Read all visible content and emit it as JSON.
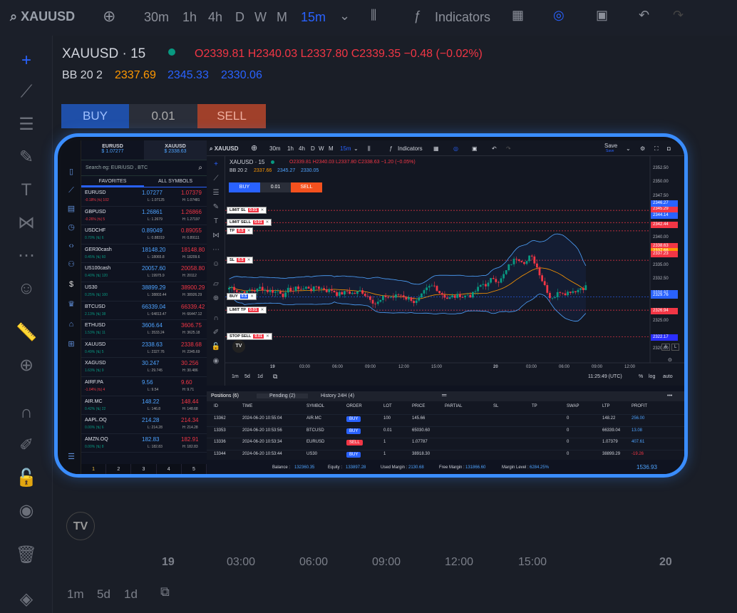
{
  "bg": {
    "symbol": "XAUUSD",
    "intervals": [
      "30m",
      "1h",
      "4h",
      "D",
      "W",
      "M",
      "15m"
    ],
    "indicators_label": "Indicators",
    "legend_title": "XAUUSD · 15",
    "ohlc": "O2339.81 H2340.03 L2337.80 C2339.35 −0.48 (−0.02%)",
    "bb": "BB 20 2",
    "bb_vals": [
      "2337.69",
      "2345.33",
      "2330.06"
    ],
    "buy": "BUY",
    "qty": "0.01",
    "sell": "SELL",
    "time_labels": [
      "19",
      "03:00",
      "06:00",
      "09:00",
      "12:00",
      "15:00",
      "20"
    ],
    "ranges": [
      "1m",
      "5d",
      "1d"
    ]
  },
  "watchlist": {
    "header": [
      {
        "sym": "EURUSD",
        "price": "$ 1.07277"
      },
      {
        "sym": "XAUUSD",
        "price": "$ 2338.63"
      }
    ],
    "search_placeholder": "Search eg: EUR/USD , BTC",
    "tabs": [
      "FAVORITES",
      "ALL SYMBOLS"
    ],
    "rows": [
      {
        "sym": "EURUSD",
        "chg": "-0.18% |⇅| 102",
        "bid": "1.07277",
        "ask": "1.07379",
        "lo": "L: 1.07125",
        "hi": "H: 1.07481",
        "up": false
      },
      {
        "sym": "GBPUSD",
        "chg": "-0.26% |⇅| 5",
        "bid": "1.26861",
        "ask": "1.26866",
        "lo": "L: 1.2679",
        "hi": "H: 1.27197",
        "up": false
      },
      {
        "sym": "USDCHF",
        "chg": "0.70% |⇅| 6",
        "bid": "0.89049",
        "ask": "0.89055",
        "lo": "L: 0.88319",
        "hi": "H: 0.89111",
        "up": true
      },
      {
        "sym": "GER30cash",
        "chg": "0.45% |⇅| 60",
        "bid": "18148.20",
        "ask": "18148.80",
        "lo": "L: 18065.8",
        "hi": "H: 18209.6",
        "up": true
      },
      {
        "sym": "US100cash",
        "chg": "0.40% |⇅| 120",
        "bid": "20057.60",
        "ask": "20058.80",
        "lo": "L: 19975.9",
        "hi": "H: 20112",
        "up": true
      },
      {
        "sym": "US30",
        "chg": "0.25% |⇅| 100",
        "bid": "38899.29",
        "ask": "38900.29",
        "lo": "L: 38803.44",
        "hi": "H: 38926.29",
        "up": true
      },
      {
        "sym": "BTCUSD",
        "chg": "2.13% |⇅| 38",
        "bid": "66339.04",
        "ask": "66339.42",
        "lo": "L: 64813.47",
        "hi": "H: 66447.12",
        "up": true
      },
      {
        "sym": "ETHUSD",
        "chg": "1.53% |⇅| 11",
        "bid": "3606.64",
        "ask": "3606.75",
        "lo": "L: 3533.24",
        "hi": "H: 3625.18",
        "up": true
      },
      {
        "sym": "XAUUSD",
        "chg": "0.49% |⇅| 5",
        "bid": "2338.63",
        "ask": "2338.68",
        "lo": "L: 2327.76",
        "hi": "H: 2345.69",
        "up": true
      },
      {
        "sym": "XAGUSD",
        "chg": "1.63% |⇅| 9",
        "bid": "30.247",
        "ask": "30.256",
        "lo": "L: 29.745",
        "hi": "H: 30.486",
        "up": true
      },
      {
        "sym": "AIRF.PA",
        "chg": "-1.04% |⇅| 4",
        "bid": "9.56",
        "ask": "9.60",
        "lo": "L: 9.54",
        "hi": "H: 9.71",
        "up": false
      },
      {
        "sym": "AIR.MC",
        "chg": "0.42% |⇅| 22",
        "bid": "148.22",
        "ask": "148.44",
        "lo": "L: 146.8",
        "hi": "H: 148.68",
        "up": true
      },
      {
        "sym": "AAPL.OQ",
        "chg": "0.00% |⇅| 6",
        "bid": "214.28",
        "ask": "214.34",
        "lo": "L: 214.28",
        "hi": "H: 214.28",
        "up": true
      },
      {
        "sym": "AMZN.OQ",
        "chg": "0.00% |⇅| 8",
        "bid": "182.83",
        "ask": "182.91",
        "lo": "L: 182.83",
        "hi": "H: 182.83",
        "up": true
      }
    ],
    "pages": [
      "1",
      "2",
      "3",
      "4",
      "5"
    ]
  },
  "toolbar": {
    "symbol": "XAUUSD",
    "intervals": [
      "30m",
      "1h",
      "4h",
      "D",
      "W",
      "M",
      "15m"
    ],
    "indicators_label": "Indicators",
    "save_label": "Save",
    "save_sub": "Save"
  },
  "chart": {
    "legend_title": "XAUUSD · 15",
    "ohlc": "O2339.81 H2340.03 L2337.80 C2338.63 −1.20 (−0.05%)",
    "bb": "BB 20 2",
    "bb_vals": [
      "2337.66",
      "2345.27",
      "2330.05"
    ],
    "buy": "BUY",
    "qty": "0.01",
    "sell": "SELL",
    "price_ticks": [
      "2352.50",
      "2350.00",
      "2347.50",
      "2340.00",
      "2335.00",
      "2332.50",
      "2325.00",
      "2320.00"
    ],
    "price_tags": [
      {
        "v": "2345.29",
        "c": "#f23645"
      },
      {
        "v": "2346.27",
        "c": "#2962ff"
      },
      {
        "v": "2344.14",
        "c": "#2962ff"
      },
      {
        "v": "2342.44",
        "c": "#f23645"
      },
      {
        "v": "2338.63",
        "c": "#f23645"
      },
      {
        "v": "2337.66",
        "c": "#ff9800"
      },
      {
        "v": "2337.23",
        "c": "#f23645"
      },
      {
        "v": "2330.05",
        "c": "#2962ff"
      },
      {
        "v": "2329.91",
        "c": "#2962ff"
      },
      {
        "v": "2329.76",
        "c": "#2962ff"
      },
      {
        "v": "2326.94",
        "c": "#f23645"
      },
      {
        "v": "2322.17",
        "c": "#2a2eff"
      }
    ],
    "order_lines": [
      {
        "label": "LIMIT SL",
        "val": "0.01",
        "col": "#f23645"
      },
      {
        "label": "LIMIT SELL",
        "val": "0.01",
        "col": "#f23645"
      },
      {
        "label": "TP",
        "val": "0.5",
        "col": "#f23645"
      },
      {
        "label": "SL",
        "val": "0.5",
        "col": "#f23645"
      },
      {
        "label": "BUY",
        "val": "0.5",
        "col": "#2962ff"
      },
      {
        "label": "LIMIT TP",
        "val": "0.01",
        "col": "#f23645"
      },
      {
        "label": "STOP SELL",
        "val": "0.01",
        "col": "#f23645"
      }
    ],
    "time_labels": [
      "19",
      "03:00",
      "06:00",
      "09:00",
      "12:00",
      "15:00",
      "20",
      "03:00",
      "06:00",
      "09:00",
      "12:00"
    ],
    "ranges": [
      "1m",
      "5d",
      "1d"
    ],
    "clock": "11:25:49 (UTC)",
    "pct": "%",
    "log": "log",
    "auto": "auto"
  },
  "positions": {
    "tabs": [
      "Positions (6)",
      "Pending (2)",
      "History 24H (4)"
    ],
    "columns": [
      "ID",
      "TIME",
      "SYMBOL",
      "ORDER",
      "LOT",
      "PRICE",
      "PARTIAL",
      "SL",
      "TP",
      "SWAP",
      "LTP",
      "PROFIT"
    ],
    "rows": [
      {
        "id": "13362",
        "time": "2024-06-20 10:55:04",
        "sym": "AIR.MC",
        "order": "BUY",
        "lot": "100",
        "price": "145.66",
        "swap": "0",
        "ltp": "148.22",
        "profit": "256.00",
        "pos": true
      },
      {
        "id": "13353",
        "time": "2024-06-20 10:53:56",
        "sym": "BTCUSD",
        "order": "BUY",
        "lot": "0.01",
        "price": "65030.60",
        "swap": "0",
        "ltp": "66339.04",
        "profit": "13.08",
        "pos": true
      },
      {
        "id": "13336",
        "time": "2024-06-20 10:53:34",
        "sym": "EURUSD",
        "order": "SELL",
        "lot": "1",
        "price": "1.07787",
        "swap": "0",
        "ltp": "1.07379",
        "profit": "407.61",
        "pos": true
      },
      {
        "id": "13344",
        "time": "2024-06-20 10:53:44",
        "sym": "US30",
        "order": "BUY",
        "lot": "1",
        "price": "38918.30",
        "swap": "0",
        "ltp": "38899.29",
        "profit": "-19.26",
        "pos": false
      }
    ]
  },
  "status": {
    "balance_label": "Balance :",
    "balance": "132360.35",
    "equity_label": "Equity :",
    "equity": "133897.28",
    "used_label": "Used Margin :",
    "used": "2130.68",
    "free_label": "Free Margin :",
    "free": "131866.60",
    "level_label": "Margin Level :",
    "level": "6284.25%",
    "total": "1536.93"
  }
}
